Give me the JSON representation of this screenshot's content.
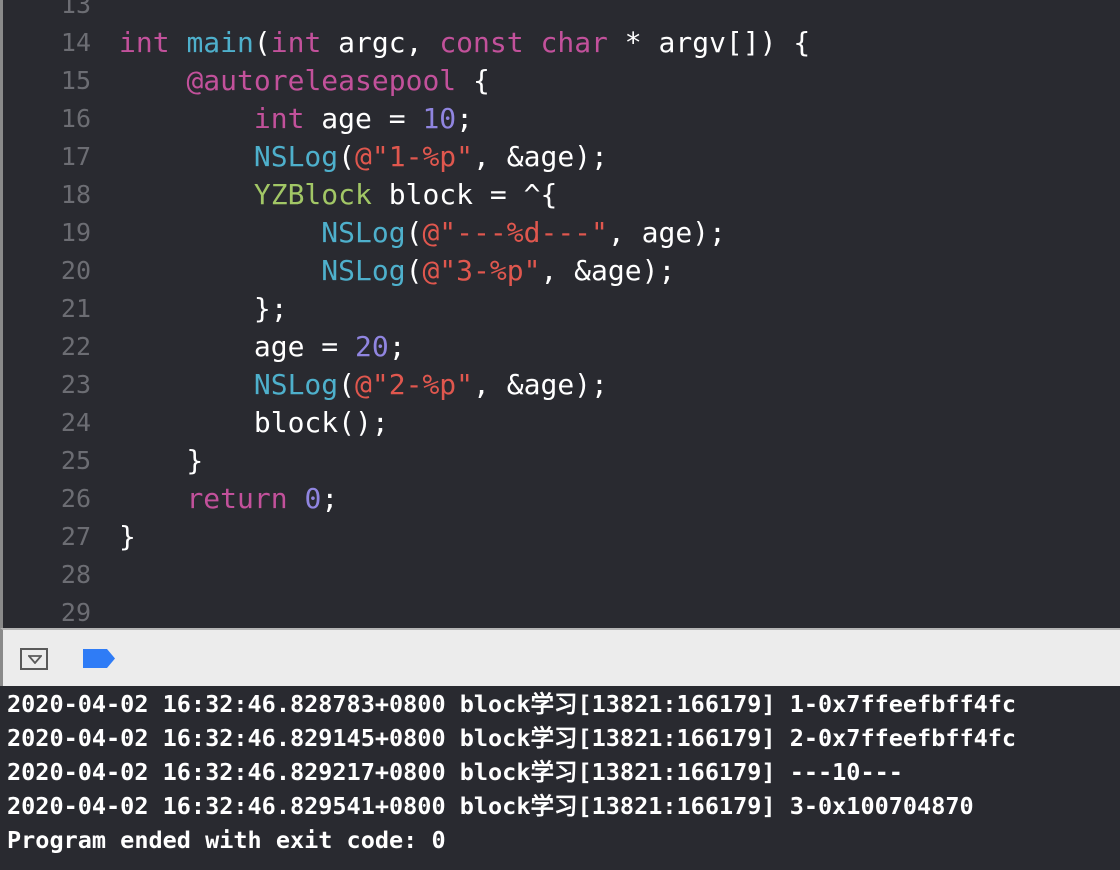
{
  "editor": {
    "lines": [
      {
        "n": "13",
        "tokens": []
      },
      {
        "n": "14",
        "tokens": [
          [
            "kw",
            "int"
          ],
          [
            "plain",
            " "
          ],
          [
            "fn",
            "main"
          ],
          [
            "plain",
            "("
          ],
          [
            "kw",
            "int"
          ],
          [
            "plain",
            " argc, "
          ],
          [
            "kw",
            "const"
          ],
          [
            "plain",
            " "
          ],
          [
            "kw",
            "char"
          ],
          [
            "plain",
            " * argv[]) {"
          ]
        ]
      },
      {
        "n": "15",
        "tokens": [
          [
            "plain",
            "    "
          ],
          [
            "kw",
            "@autoreleasepool"
          ],
          [
            "plain",
            " {"
          ]
        ]
      },
      {
        "n": "16",
        "tokens": [
          [
            "plain",
            "        "
          ],
          [
            "kw",
            "int"
          ],
          [
            "plain",
            " age = "
          ],
          [
            "num",
            "10"
          ],
          [
            "plain",
            ";"
          ]
        ]
      },
      {
        "n": "17",
        "tokens": [
          [
            "plain",
            "        "
          ],
          [
            "fn",
            "NSLog"
          ],
          [
            "plain",
            "("
          ],
          [
            "str",
            "@\"1-%p\""
          ],
          [
            "plain",
            ", &age);"
          ]
        ]
      },
      {
        "n": "18",
        "tokens": [
          [
            "plain",
            "        "
          ],
          [
            "type",
            "YZBlock"
          ],
          [
            "plain",
            " block = ^{"
          ]
        ]
      },
      {
        "n": "19",
        "tokens": [
          [
            "plain",
            "            "
          ],
          [
            "fn",
            "NSLog"
          ],
          [
            "plain",
            "("
          ],
          [
            "str",
            "@\"---%d---\""
          ],
          [
            "plain",
            ", age);"
          ]
        ]
      },
      {
        "n": "20",
        "tokens": [
          [
            "plain",
            "            "
          ],
          [
            "fn",
            "NSLog"
          ],
          [
            "plain",
            "("
          ],
          [
            "str",
            "@\"3-%p\""
          ],
          [
            "plain",
            ", &age);"
          ]
        ]
      },
      {
        "n": "21",
        "tokens": [
          [
            "plain",
            "        };"
          ]
        ]
      },
      {
        "n": "22",
        "tokens": [
          [
            "plain",
            "        age = "
          ],
          [
            "num",
            "20"
          ],
          [
            "plain",
            ";"
          ]
        ]
      },
      {
        "n": "23",
        "tokens": [
          [
            "plain",
            "        "
          ],
          [
            "fn",
            "NSLog"
          ],
          [
            "plain",
            "("
          ],
          [
            "str",
            "@\"2-%p\""
          ],
          [
            "plain",
            ", &age);"
          ]
        ]
      },
      {
        "n": "24",
        "tokens": [
          [
            "plain",
            "        block();"
          ]
        ]
      },
      {
        "n": "25",
        "tokens": [
          [
            "plain",
            "    }"
          ]
        ]
      },
      {
        "n": "26",
        "tokens": [
          [
            "plain",
            "    "
          ],
          [
            "kw",
            "return"
          ],
          [
            "plain",
            " "
          ],
          [
            "num",
            "0"
          ],
          [
            "plain",
            ";"
          ]
        ]
      },
      {
        "n": "27",
        "tokens": [
          [
            "plain",
            "}"
          ]
        ]
      },
      {
        "n": "28",
        "tokens": []
      },
      {
        "n": "29",
        "tokens": []
      }
    ]
  },
  "toolbar": {
    "hide_icon": "triangle-down-in-box",
    "breakpoint_icon": "breakpoint-tag",
    "breakpoint_color": "#2f7cf6"
  },
  "console": {
    "lines": [
      "2020-04-02 16:32:46.828783+0800 block学习[13821:166179] 1-0x7ffeefbff4fc",
      "2020-04-02 16:32:46.829145+0800 block学习[13821:166179] 2-0x7ffeefbff4fc",
      "2020-04-02 16:32:46.829217+0800 block学习[13821:166179] ---10---",
      "2020-04-02 16:32:46.829541+0800 block学习[13821:166179] 3-0x100704870",
      "Program ended with exit code: 0"
    ]
  }
}
